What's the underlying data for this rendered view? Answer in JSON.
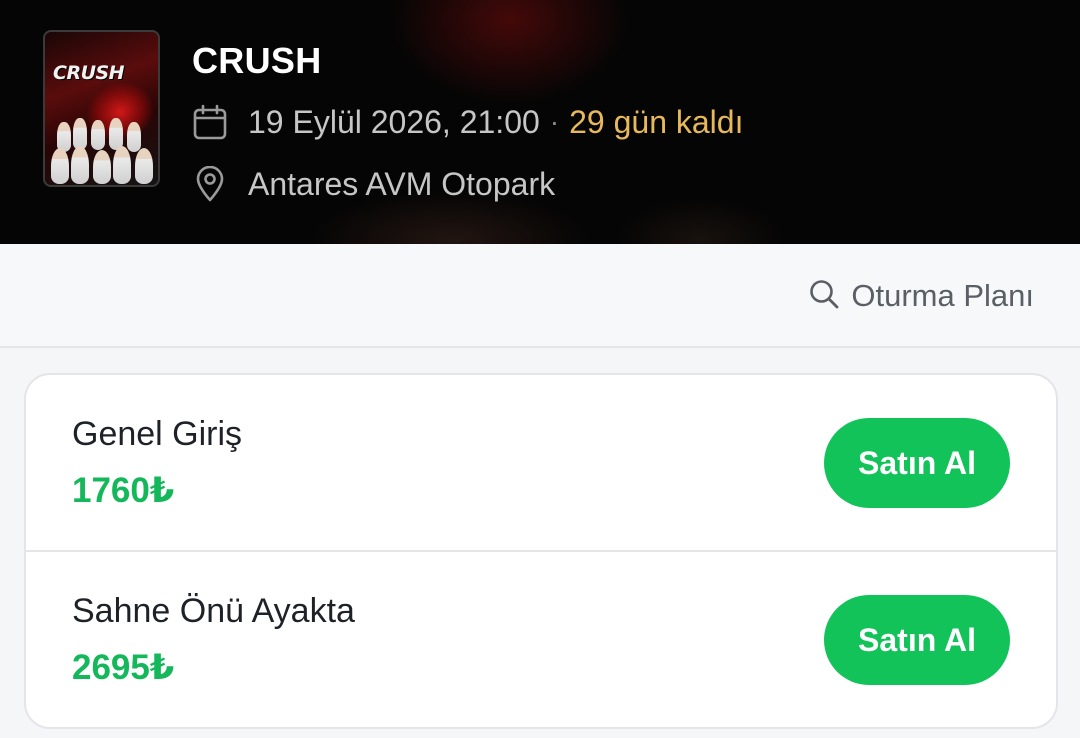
{
  "event": {
    "poster_logo": "CRUSH",
    "title": "CRUSH",
    "date": "19 Eylül 2026, 21:00",
    "separator": "·",
    "countdown": "29 gün kaldı",
    "venue": "Antares AVM Otopark"
  },
  "toolbar": {
    "seat_plan_label": "Oturma Planı",
    "seat_plan_icon": "search-icon"
  },
  "tickets": [
    {
      "name": "Genel Giriş",
      "price": "1760₺",
      "button_label": "Satın Al"
    },
    {
      "name": "Sahne Önü Ayakta",
      "price": "2695₺",
      "button_label": "Satın Al"
    }
  ],
  "colors": {
    "accent_green": "#12c35a",
    "price_green": "#14b85a",
    "countdown_gold": "#e7b95a",
    "header_bg": "#050505"
  }
}
